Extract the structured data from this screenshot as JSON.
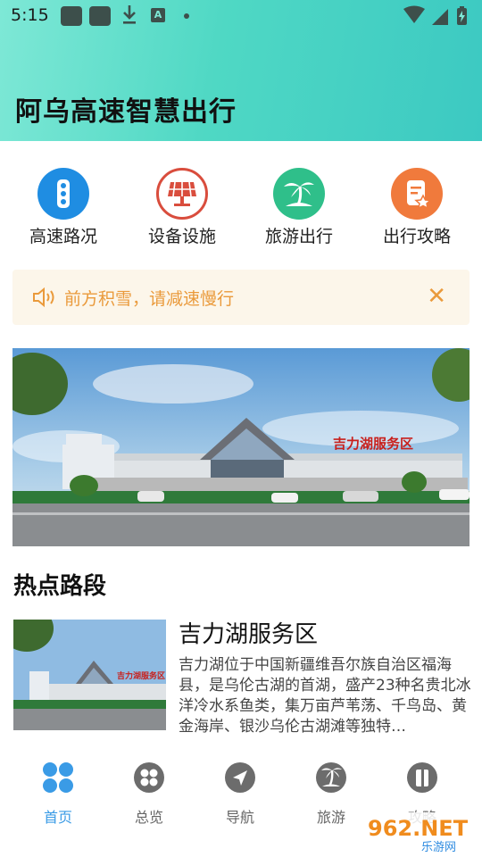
{
  "status_bar": {
    "time": "5:15"
  },
  "app_title": "阿乌高速智慧出行",
  "quick_menu": [
    {
      "label": "高速路况",
      "icon": "traffic-light-icon",
      "color": "#1f8de2"
    },
    {
      "label": "设备设施",
      "icon": "solar-panel-icon",
      "color": "#d94d3d"
    },
    {
      "label": "旅游出行",
      "icon": "palm-tree-icon",
      "color": "#2fbf8a"
    },
    {
      "label": "出行攻略",
      "icon": "guide-book-icon",
      "color": "#f07a3c"
    }
  ],
  "notice": {
    "text": "前方积雪，请减速慢行",
    "icon": "speaker-icon",
    "close_icon": "close-icon"
  },
  "banner": {
    "sign_text": "吉力湖服务区"
  },
  "section": {
    "title": "热点路段"
  },
  "hot_roads": [
    {
      "name": "吉力湖服务区",
      "description": "吉力湖位于中国新疆维吾尔族自治区福海县，是乌伦古湖的首湖，盛产23种名贵北冰洋冷水系鱼类，集万亩芦苇荡、千鸟岛、黄金海岸、银沙乌伦古湖滩等独特…",
      "thumb_sign": "吉力湖服务区"
    }
  ],
  "bottom_nav": [
    {
      "label": "首页",
      "icon": "home-grid-icon",
      "active": true
    },
    {
      "label": "总览",
      "icon": "overview-icon",
      "active": false
    },
    {
      "label": "导航",
      "icon": "navigation-icon",
      "active": false
    },
    {
      "label": "旅游",
      "icon": "travel-icon",
      "active": false
    },
    {
      "label": "攻略",
      "icon": "guide-icon",
      "active": false
    }
  ],
  "watermark": {
    "text": "962.NET",
    "sub": "乐游网"
  },
  "colors": {
    "accent": "#3a9be6",
    "notice": "#ea9a3b",
    "header": "#4fd8c4"
  }
}
